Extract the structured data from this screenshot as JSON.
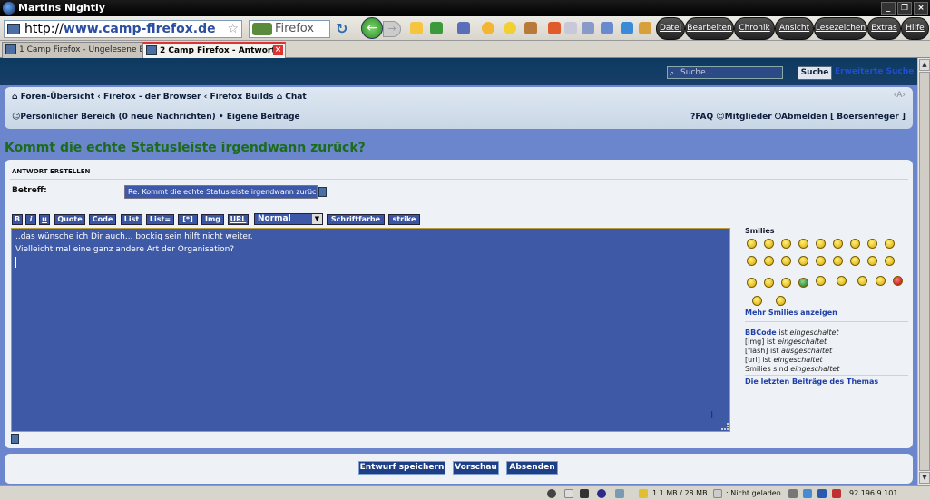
{
  "window": {
    "title": "Martins Nightly"
  },
  "navbar": {
    "url_prefix": "http://",
    "url_domain": "www.camp-firefox.de",
    "search_engine_label": "Firefox",
    "menus": [
      "Datei",
      "Bearbeiten",
      "Chronik",
      "Ansicht",
      "Lesezeichen",
      "Extras",
      "Hilfe"
    ]
  },
  "tabs": [
    {
      "label": "1 Camp Firefox - Ungelesene B"
    },
    {
      "label": "2 Camp Firefox - Antwort"
    }
  ],
  "site": {
    "search": {
      "placeholder": "Suche...",
      "button": "Suche",
      "advanced": "Erweiterte Suche"
    },
    "breadcrumb": [
      "Foren-Übersicht",
      "Firefox - der Browser",
      "Firefox Builds",
      "Chat"
    ],
    "font_size_label": "‹A›",
    "user_links_left": [
      "Persönlicher Bereich (0 neue Nachrichten)",
      "Eigene Beiträge"
    ],
    "user_links_right": [
      "FAQ",
      "Mitglieder",
      "Abmelden [ Boersenfeger ]"
    ],
    "page_title": "Kommt die echte Statusleiste irgendwann zurück?"
  },
  "form": {
    "header": "ANTWORT ERSTELLEN",
    "subject_label": "Betreff:",
    "subject_value": "Re: Kommt die echte Statusleiste irgendwann zurück?",
    "toolbar": [
      "B",
      "i",
      "u",
      "Quote",
      "Code",
      "List",
      "List=",
      "[*]",
      "Img",
      "URL"
    ],
    "font_size_select": "Normal",
    "font_color": "Schriftfarbe",
    "strike": "strike",
    "message_lines": [
      "..das wünsche ich Dir auch... bockig sein hilft nicht weiter.",
      "Vielleicht mal eine ganz andere Art der Organisation?"
    ],
    "buttons": {
      "save_draft": "Entwurf speichern",
      "preview": "Vorschau",
      "submit": "Absenden"
    }
  },
  "sidebar": {
    "smilies_title": "Smilies",
    "more_smilies": "Mehr Smilies anzeigen",
    "status": [
      {
        "name": "BBCode",
        "mid": " ist ",
        "state": "eingeschaltet"
      },
      {
        "name": "[img]",
        "mid": " ist ",
        "state": "eingeschaltet"
      },
      {
        "name": "[flash]",
        "mid": " ist ",
        "state": "ausgeschaltet"
      },
      {
        "name": "[url]",
        "mid": " ist ",
        "state": "eingeschaltet"
      },
      {
        "name": "Smilies",
        "mid": " sind ",
        "state": "eingeschaltet"
      }
    ],
    "last_posts": "Die letzten Beiträge des Themas"
  },
  "statusbar": {
    "memory": "1.1 MB / 28 MB",
    "load_state": ": Nicht geladen",
    "ip": "92.196.9.101"
  }
}
